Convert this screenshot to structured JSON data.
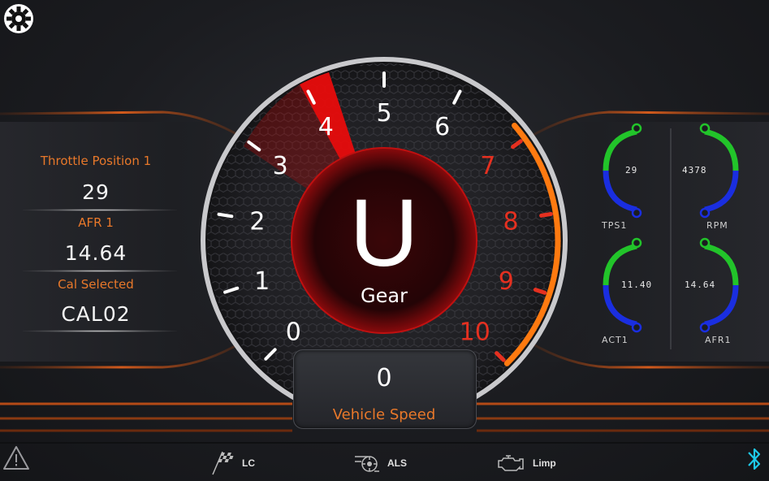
{
  "left": {
    "rows": [
      {
        "label": "Throttle Position 1",
        "value": "29"
      },
      {
        "label": "AFR 1",
        "value": "14.64"
      },
      {
        "label": "Cal Selected",
        "value": "CAL02"
      }
    ]
  },
  "gauge": {
    "ticks": [
      "0",
      "1",
      "2",
      "3",
      "4",
      "5",
      "6",
      "7",
      "8",
      "9",
      "10"
    ],
    "gear": "U",
    "gear_label": "Gear",
    "redline_color": "#e53020",
    "normal_color": "#ffffff"
  },
  "speed": {
    "value": "0",
    "label": "Vehicle Speed"
  },
  "mini_gauges": [
    {
      "label": "TPS1",
      "value": "29"
    },
    {
      "label": "RPM",
      "value": "4378"
    },
    {
      "label": "ACT1",
      "value": "11.40"
    },
    {
      "label": "AFR1",
      "value": "14.64"
    }
  ],
  "bottom": {
    "lc": "LC",
    "als": "ALS",
    "limp": "Limp"
  },
  "icons": {
    "settings": "gear-icon",
    "warning": "warning-icon",
    "bluetooth": "bluetooth-icon",
    "lc": "checkered-flag-icon",
    "als": "turbo-icon",
    "limp": "engine-icon"
  },
  "colors": {
    "accent": "#e8782a",
    "green": "#22c42a",
    "blue": "#1a2ee0",
    "bluetooth": "#1ec8e8"
  }
}
